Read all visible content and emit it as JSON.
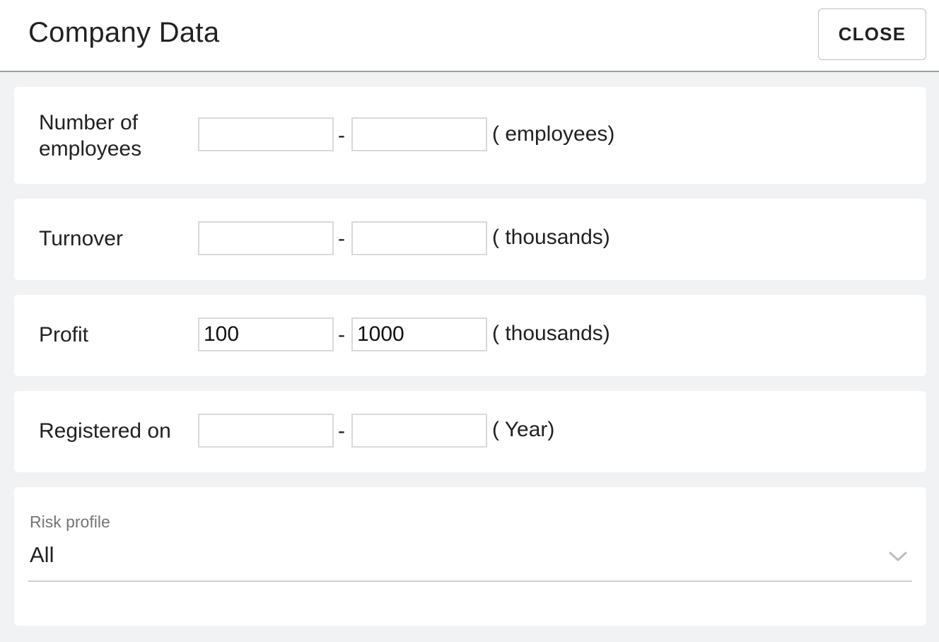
{
  "header": {
    "title": "Company Data",
    "close_label": "CLOSE"
  },
  "rows": [
    {
      "label_line1": "Number of",
      "label_line2": "employees",
      "from": "",
      "to": "",
      "separator": "-",
      "unit": "( employees)"
    },
    {
      "label": "Turnover",
      "from": "",
      "to": "",
      "separator": "-",
      "unit": "( thousands)"
    },
    {
      "label": "Profit",
      "from": "100",
      "to": "1000",
      "separator": "-",
      "unit": "( thousands)"
    },
    {
      "label": "Registered on",
      "from": "",
      "to": "",
      "separator": "-",
      "unit": "( Year)"
    }
  ],
  "risk_profile": {
    "label": "Risk profile",
    "selected": "All",
    "icon": "chevron-down-icon"
  },
  "colors": {
    "background": "#f0f2f4",
    "card": "#ffffff",
    "border": "#d9d9d9",
    "text": "#212121",
    "muted_label": "#757575"
  }
}
